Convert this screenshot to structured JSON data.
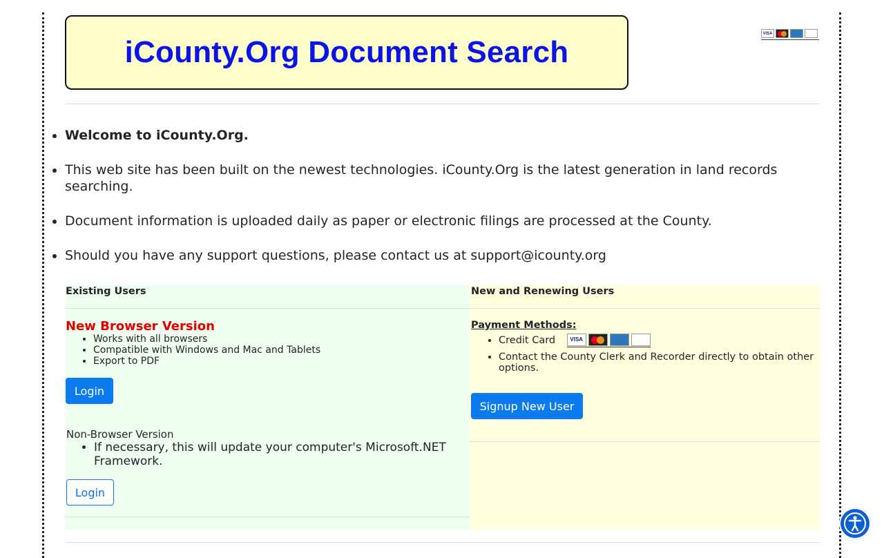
{
  "banner": {
    "title": "iCounty.Org Document Search"
  },
  "header_cards": [
    "VISA",
    "MasterCard",
    "AMEX",
    "DISCOVER"
  ],
  "intro": {
    "welcome": "Welcome to iCounty.Org.",
    "item2": "This web site has been built on the newest technologies. iCounty.Org is the latest generation in land records searching.",
    "item3": "Document information is uploaded daily as paper or electronic filings are processed at the County.",
    "item4": "Should you have any support questions, please contact us at support@icounty.org"
  },
  "existing": {
    "heading": "Existing Users",
    "new_version_title": "New Browser Version",
    "features": [
      "Works with all browsers",
      "Compatible with Windows and Mac and Tablets",
      "Export to PDF"
    ],
    "login_label": "Login",
    "non_browser_label": "Non-Browser Version",
    "non_browser_note": "If necessary, this will update your computer's Microsoft.NET Framework.",
    "login2_label": "Login"
  },
  "renewing": {
    "heading": "New and Renewing Users",
    "payment_title": "Payment Methods:",
    "credit_card": "Credit Card",
    "contact_note": "Contact the County Clerk and Recorder directly to obtain other options.",
    "signup_label": "Signup New User"
  },
  "colors": {
    "banner_bg": "#ffffcc",
    "title_blue": "#0a14e6",
    "alert_red": "#e00000",
    "button_blue": "#0d7bf0"
  },
  "icons": {
    "accessibility": "accessibility-icon"
  }
}
